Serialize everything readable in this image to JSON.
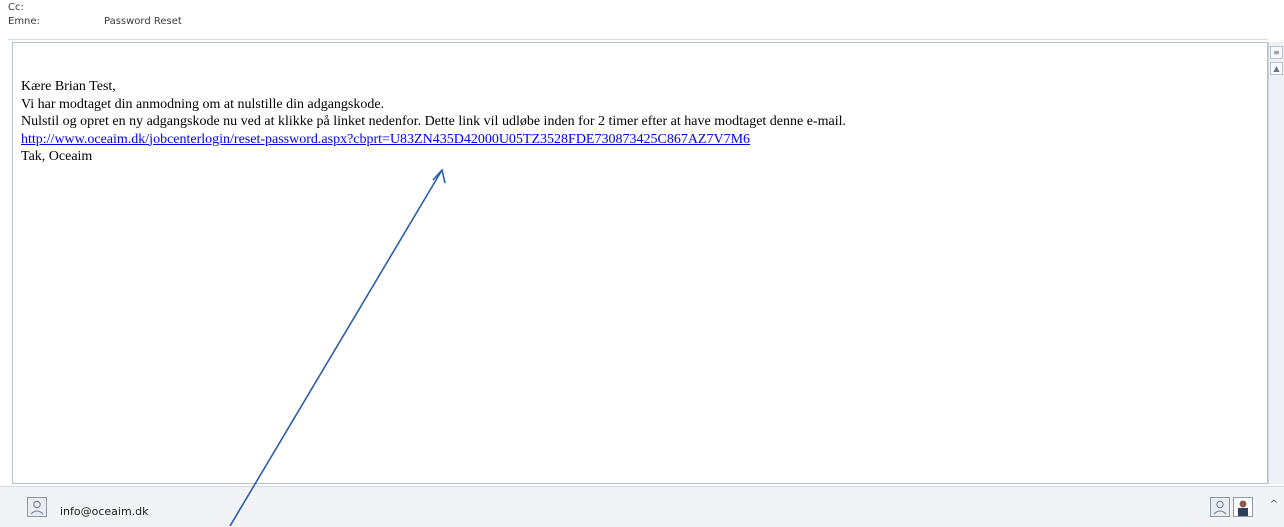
{
  "header": {
    "cc_label": "Cc:",
    "subject_label": "Emne:",
    "subject_value": "Password Reset"
  },
  "email": {
    "greeting": "Kære Brian Test,",
    "line1": "Vi har modtaget din anmodning om at nulstille din adgangskode.",
    "line2": "Nulstil og opret en ny adgangskode nu ved at klikke på linket nedenfor. Dette link vil udløbe inden for 2 timer efter at have modtaget denne e-mail.",
    "link": "http://www.oceaim.dk/jobcenterlogin/reset-password.aspx?cbprt=U83ZN435D42000U05TZ3528FDE730873425C867AZ7V7M6",
    "signoff": "Tak, Oceaim"
  },
  "footer": {
    "sender": "info@oceaim.dk"
  },
  "colors": {
    "link": "#0000ee",
    "arrow": "#2b5ea8"
  },
  "icons": [
    "person-icon",
    "photo-avatar-icon",
    "chevron-up-icon"
  ]
}
